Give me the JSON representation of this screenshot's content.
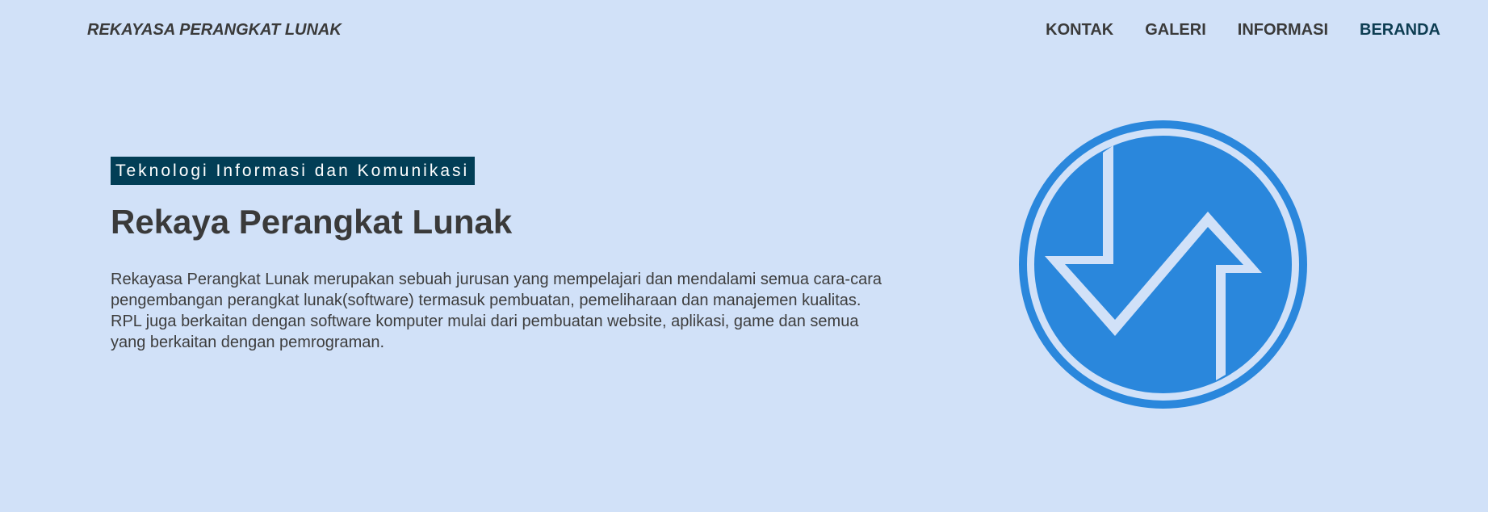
{
  "header": {
    "brand": "REKAYASA PERANGKAT LUNAK",
    "nav": [
      {
        "label": "KONTAK",
        "active": false
      },
      {
        "label": "GALERI",
        "active": false
      },
      {
        "label": "INFORMASI",
        "active": false
      },
      {
        "label": "BERANDA",
        "active": true
      }
    ]
  },
  "hero": {
    "tag": "Teknologi Informasi dan Komunikasi",
    "title": "Rekaya Perangkat Lunak",
    "description": "Rekayasa Perangkat Lunak merupakan sebuah jurusan yang mempelajari dan mendalami semua cara-cara pengembangan perangkat lunak(software) termasuk pembuatan, pemeliharaan dan manajemen kualitas. RPL juga berkaitan dengan software komputer mulai dari pembuatan website, aplikasi, game dan semua yang berkaitan dengan pemrograman."
  },
  "logo": {
    "icon": "rpl-arrows-logo-icon",
    "circle_color": "#2a87dc",
    "ring_color": "#d1e1f8"
  },
  "colors": {
    "background": "#d1e1f8",
    "tag_background": "#023e56",
    "active_nav": "#0d3d52"
  }
}
